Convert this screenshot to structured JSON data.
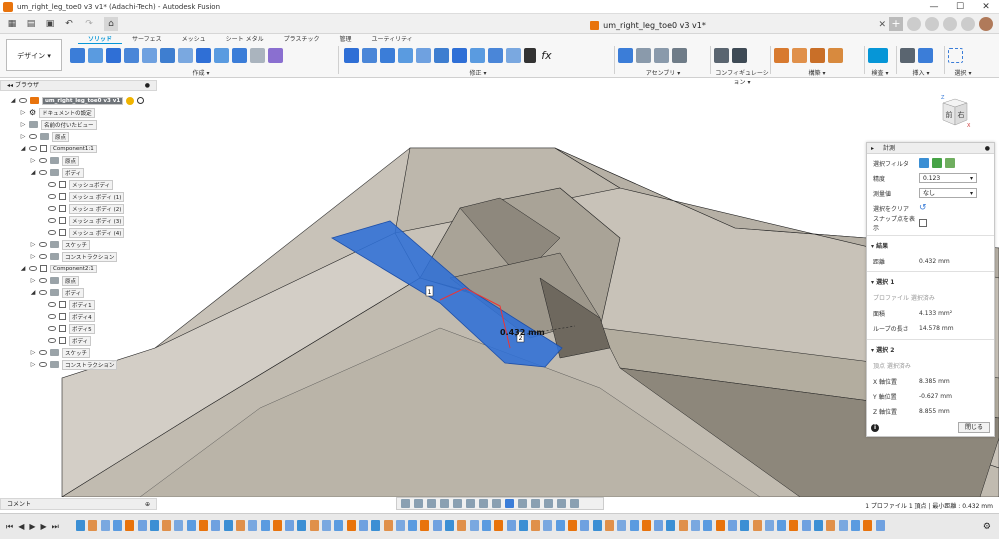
{
  "window": {
    "title": "um_right_leg_toe0 v3 v1* (Adachi-Tech) - Autodesk Fusion",
    "controls": [
      "—",
      "☐",
      "✕"
    ]
  },
  "doc_tab": {
    "label": "um_right_leg_toe0 v3 v1*",
    "close": "✕"
  },
  "ribbon": {
    "workspace": "デザイン ▾",
    "tabs": [
      "ソリッド",
      "サーフェス",
      "メッシュ",
      "シート メタル",
      "プラスチック",
      "管理",
      "ユーティリティ"
    ],
    "groups": [
      "作成 ▾",
      "修正 ▾",
      "アセンブリ ▾",
      "コンフィギュレーション ▾",
      "構築 ▾",
      "検査 ▾",
      "挿入 ▾",
      "選択 ▾"
    ],
    "fx_label": "fx"
  },
  "browser": {
    "title": "ブラウザ",
    "items": [
      {
        "label": "um_right_leg_toe0 v3 v1"
      },
      {
        "label": "ドキュメントの設定"
      },
      {
        "label": "名前の付いたビュー"
      },
      {
        "label": "原点"
      },
      {
        "label": "Component1:1"
      },
      {
        "label": "原点"
      },
      {
        "label": "ボディ"
      },
      {
        "label": "メッシュボディ"
      },
      {
        "label": "メッシュ ボディ (1)"
      },
      {
        "label": "メッシュ ボディ (2)"
      },
      {
        "label": "メッシュ ボディ (3)"
      },
      {
        "label": "メッシュ ボディ (4)"
      },
      {
        "label": "スケッチ"
      },
      {
        "label": "コンストラクション"
      },
      {
        "label": "Component2:1"
      },
      {
        "label": "原点"
      },
      {
        "label": "ボディ"
      },
      {
        "label": "ボディ1"
      },
      {
        "label": "ボディ4"
      },
      {
        "label": "ボディ5"
      },
      {
        "label": "ボディ"
      },
      {
        "label": "スケッチ"
      },
      {
        "label": "コンストラクション"
      }
    ]
  },
  "viewcube": {
    "front": "前",
    "right": "右",
    "axis_z": "Z",
    "axis_x": "X"
  },
  "viewport": {
    "dimension_label": "0.432 mm",
    "marker1": "1",
    "marker2": "2"
  },
  "measure": {
    "title": "計測",
    "filter_label": "選択フィルタ",
    "precision_label": "精度",
    "precision_value": "0.123",
    "unit_label": "測量値",
    "unit_value": "なし",
    "clear_label": "選択をクリア",
    "snap_label": "スナップ点を表示",
    "results_title": "結果",
    "distance_label": "距離",
    "distance_value": "0.432 mm",
    "sel1_title": "選択 1",
    "sel1_sub": "プロファイル 選択済み",
    "area_label": "面積",
    "area_value": "4.133 mm²",
    "loop_label": "ループの長さ",
    "loop_value": "14.578 mm",
    "sel2_title": "選択 2",
    "sel2_sub": "頂点 選択済み",
    "x_label": "X 軸位置",
    "x_value": "8.385 mm",
    "y_label": "Y 軸位置",
    "y_value": "-0.627 mm",
    "z_label": "Z 軸位置",
    "z_value": "8.855 mm",
    "close_label": "閉じる"
  },
  "comment": {
    "label": "コメント",
    "plus": "⊕"
  },
  "status": "1 プロファイル 1 頂点 | 最小距離 : 0.432 mm",
  "colors": {
    "accent": "#0696d7",
    "selection": "#2f6fd6",
    "model": "#bdb7ac"
  }
}
